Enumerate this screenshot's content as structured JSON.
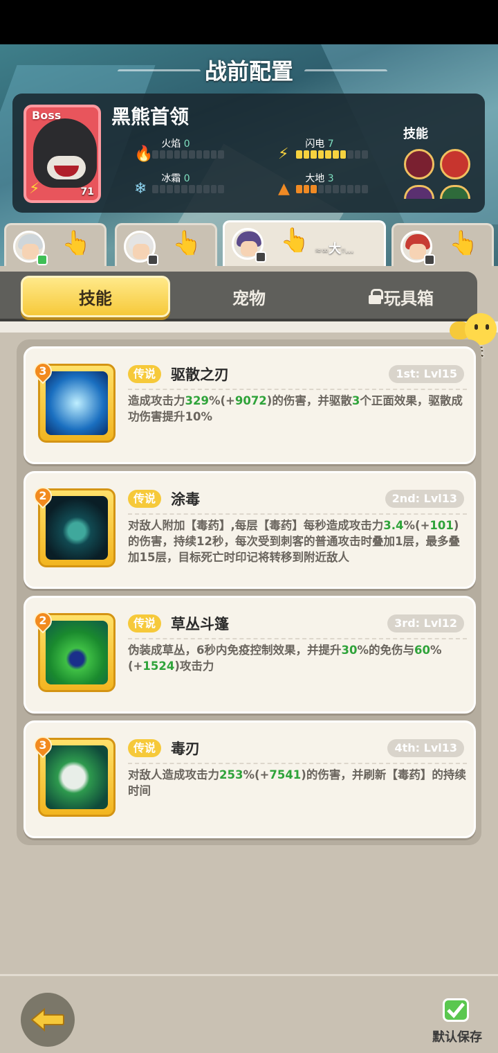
{
  "header": {
    "title": "战前配置",
    "boss": {
      "badge": "Boss",
      "name": "黑熊首领",
      "level": "71",
      "skills_label": "技能",
      "stats": [
        {
          "label": "火焰",
          "value": "0",
          "level": 0,
          "icon": "flame-icon",
          "color": "#e2453a"
        },
        {
          "label": "闪电",
          "value": "7",
          "level": 7,
          "icon": "lightning-icon",
          "color": "#f6d23f"
        },
        {
          "label": "冰霜",
          "value": "0",
          "level": 0,
          "icon": "snowflake-icon",
          "color": "#8fd6f2"
        },
        {
          "label": "大地",
          "value": "3",
          "level": 3,
          "icon": "earth-icon",
          "color": "#f08a24"
        }
      ]
    }
  },
  "hero_tabs": [
    {
      "name": "hero-1",
      "hair_color": "#cfd6da",
      "badge": "green",
      "active": false
    },
    {
      "name": "hero-2",
      "hair_color": "#e4e4e4",
      "badge": "dark",
      "active": false
    },
    {
      "name": "hero-3",
      "hair_color": "#5b4a8a",
      "badge": "dark",
      "active": true,
      "tag": "大"
    },
    {
      "name": "hero-4",
      "hair_color": "#c73c34",
      "badge": "dark",
      "active": false
    }
  ],
  "tabs": {
    "skills": "技能",
    "pets": "宠物",
    "toybox": "玩具箱"
  },
  "chat": {
    "label": "聊天"
  },
  "skills": [
    {
      "rank": "3",
      "rarity": "传说",
      "name": "驱散之刃",
      "level": "1st: Lvl15",
      "desc": [
        {
          "t": "造成攻击力"
        },
        {
          "t": "329",
          "g": true
        },
        {
          "t": "%(+"
        },
        {
          "t": "9072",
          "g": true
        },
        {
          "t": ")的伤害，并驱散"
        },
        {
          "t": "3",
          "g": true
        },
        {
          "t": "个正面效果，驱散成功伤害提升10%"
        }
      ]
    },
    {
      "rank": "2",
      "rarity": "传说",
      "name": "涂毒",
      "level": "2nd: Lvl13",
      "desc": [
        {
          "t": "对敌人附加【毒药】,每层【毒药】每秒造成攻击力"
        },
        {
          "t": "3.4",
          "g": true
        },
        {
          "t": "%(+"
        },
        {
          "t": "101",
          "g": true
        },
        {
          "t": ")的伤害，持续12秒，每次受到刺客的普通攻击时叠加1层，最多叠加15层，目标死亡时印记将转移到附近敌人"
        }
      ]
    },
    {
      "rank": "2",
      "rarity": "传说",
      "name": "草丛斗篷",
      "level": "3rd: Lvl12",
      "desc": [
        {
          "t": "伪装成草丛，6秒内免疫控制效果，并提升"
        },
        {
          "t": "30",
          "g": true
        },
        {
          "t": "%的免伤与"
        },
        {
          "t": "60",
          "g": true
        },
        {
          "t": "%(+"
        },
        {
          "t": "1524",
          "g": true
        },
        {
          "t": ")攻击力"
        }
      ]
    },
    {
      "rank": "3",
      "rarity": "传说",
      "name": "毒刃",
      "level": "4th: Lvl13",
      "desc": [
        {
          "t": "对敌人造成攻击力"
        },
        {
          "t": "253",
          "g": true
        },
        {
          "t": "%(+"
        },
        {
          "t": "7541",
          "g": true
        },
        {
          "t": ")的伤害，并刷新【毒药】的持续时间"
        }
      ]
    }
  ],
  "footer": {
    "save_label": "默认保存"
  }
}
